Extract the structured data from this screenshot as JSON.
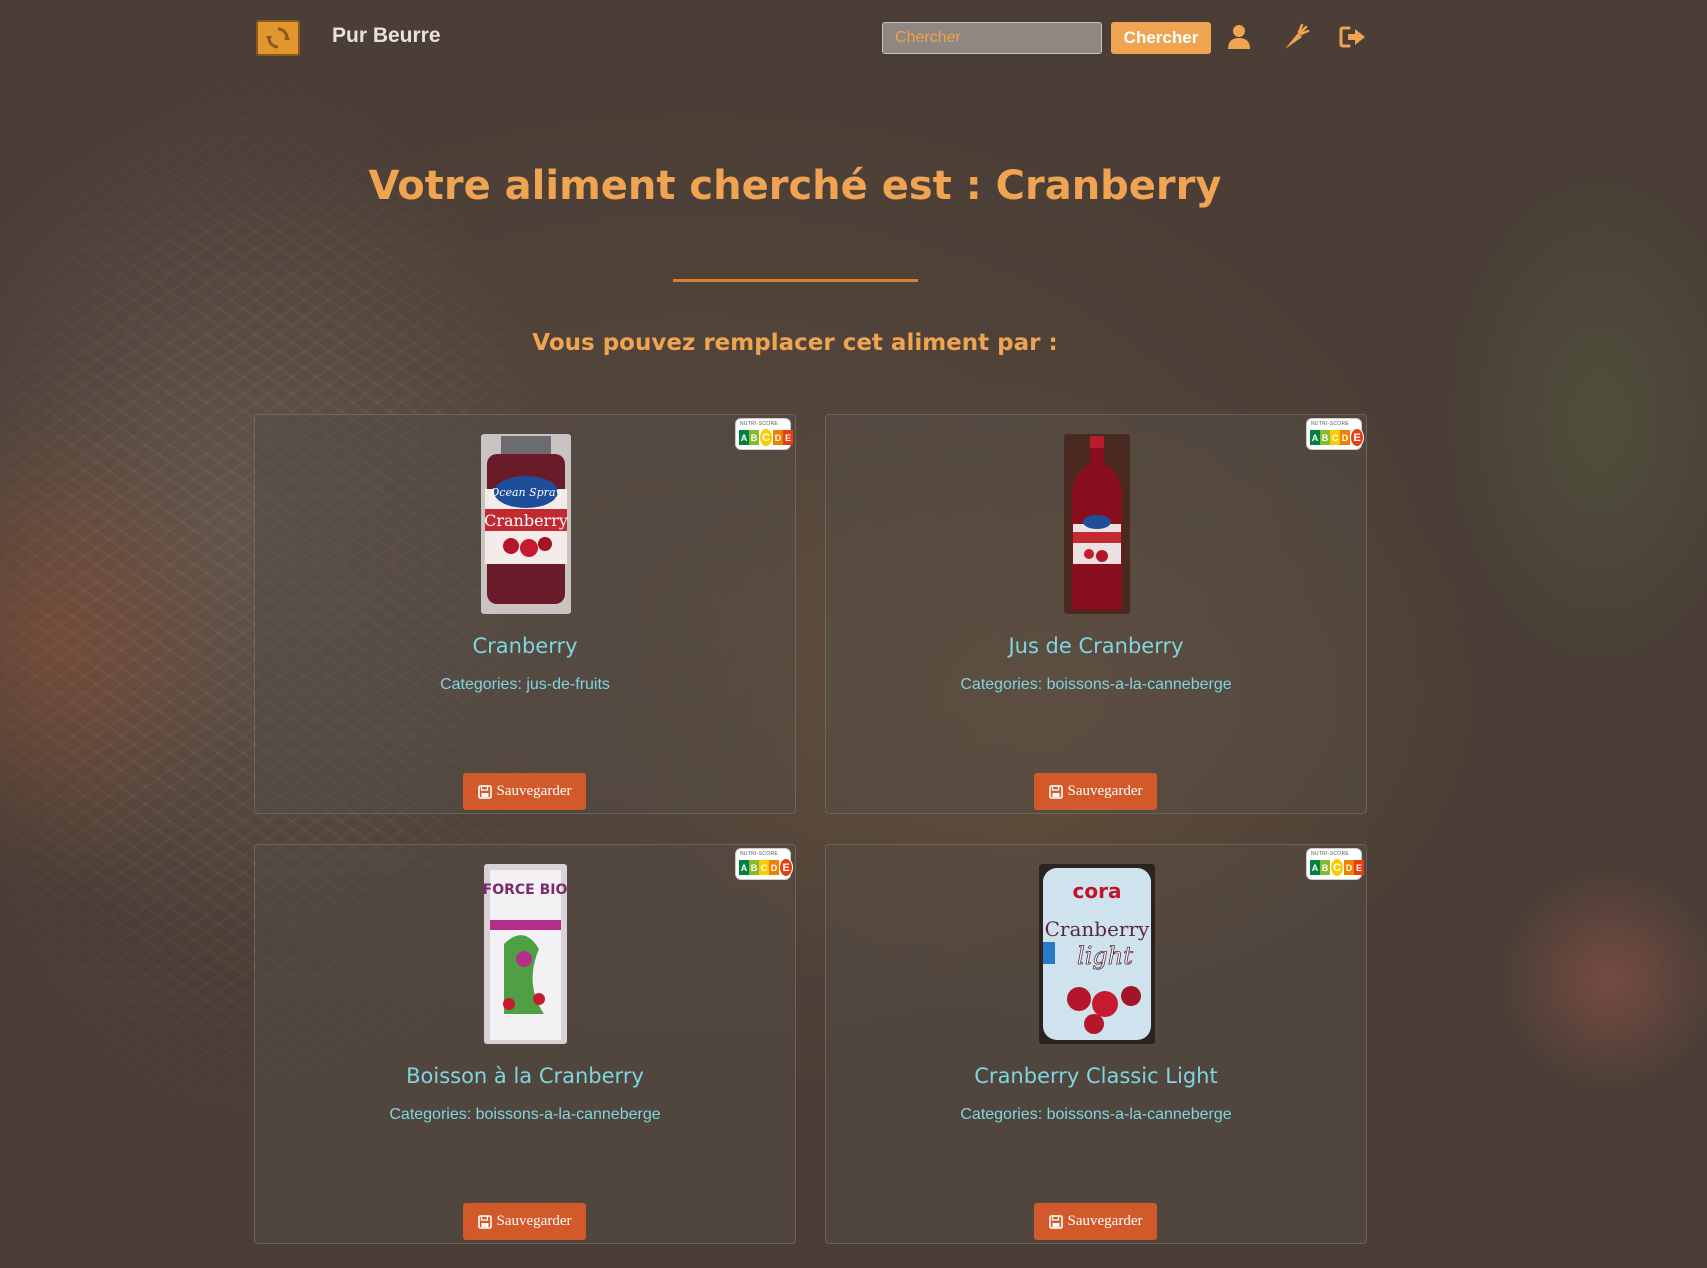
{
  "navbar": {
    "brand": "Pur Beurre",
    "search": {
      "placeholder": "Chercher",
      "value": ""
    },
    "search_button": "Chercher",
    "icons": [
      "logo-icon",
      "user-icon",
      "carrot-icon",
      "logout-icon"
    ]
  },
  "header": {
    "title": "Votre aliment cherché est : Cranberry",
    "subtitle": "Vous pouvez remplacer cet aliment par :"
  },
  "colors": {
    "accent": "#f0a452",
    "divider": "#e07d2d",
    "product_text": "#7fd5e0",
    "save_button": "#d2592a"
  },
  "products": [
    {
      "name": "Cranberry",
      "categories": "Categories: jus-de-fruits",
      "nutriscore": "C",
      "save_label": "Sauvegarder",
      "nutri_label": "NUTRI-SCORE"
    },
    {
      "name": "Jus de Cranberry",
      "categories": "Categories: boissons-a-la-canneberge",
      "nutriscore": "E",
      "save_label": "Sauvegarder",
      "nutri_label": "NUTRI-SCORE"
    },
    {
      "name": "Boisson à la Cranberry",
      "categories": "Categories: boissons-a-la-canneberge",
      "nutriscore": "E",
      "save_label": "Sauvegarder",
      "nutri_label": "NUTRI-SCORE"
    },
    {
      "name": "Cranberry Classic Light",
      "categories": "Categories: boissons-a-la-canneberge",
      "nutriscore": "C",
      "save_label": "Sauvegarder",
      "nutri_label": "NUTRI-SCORE"
    }
  ],
  "nutriscore_grades": [
    "A",
    "B",
    "C",
    "D",
    "E"
  ],
  "nutriscore_colors": [
    "#038141",
    "#85bb2f",
    "#fecb02",
    "#ee8100",
    "#e63e11"
  ],
  "label_texts": {
    "ocean_spray": "Ocean Spray",
    "cranberry": "Cranberry",
    "force_bio": "FORCE BIO",
    "cora": "cora",
    "light": "light"
  }
}
